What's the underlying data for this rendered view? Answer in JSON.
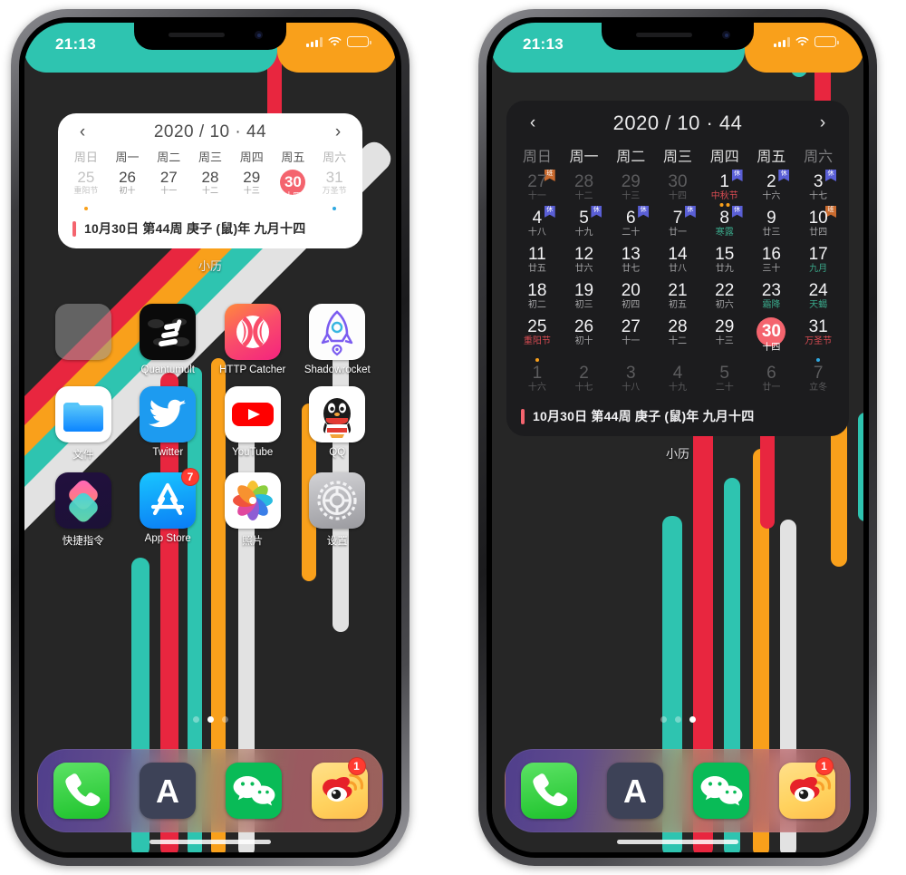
{
  "theme": {
    "teal": "#2ec4b0",
    "orange": "#f9a01b",
    "red": "#e8263f",
    "white_stripe": "#e2e2e2",
    "wallpaper_bg": "#262626",
    "today_red": "#f4646e",
    "badge_work": "#c96a2e",
    "badge_rest": "#5a5fd6",
    "app_badge_red": "#ff3b30"
  },
  "status_bar": {
    "time": "21:13",
    "signal_icon": "cellular-bars-icon",
    "wifi_icon": "wifi-icon",
    "battery_icon": "battery-icon"
  },
  "widget": {
    "prev_label": "‹",
    "next_label": "›",
    "title": "2020 / 10 · 44",
    "weekdays": [
      "周日",
      "周一",
      "周二",
      "周三",
      "周四",
      "周五",
      "周六"
    ],
    "footer_text": "10月30日 第44周 庚子 (鼠)年 九月十四",
    "app_label": "小历"
  },
  "small_widget_days": [
    {
      "num": "25",
      "sub": "重阳节",
      "out": true,
      "holiday": false,
      "dot": "#f9a01b"
    },
    {
      "num": "26",
      "sub": "初十"
    },
    {
      "num": "27",
      "sub": "十一"
    },
    {
      "num": "28",
      "sub": "十二"
    },
    {
      "num": "29",
      "sub": "十三"
    },
    {
      "num": "30",
      "sub": "十四",
      "today": true
    },
    {
      "num": "31",
      "sub": "万圣节",
      "out": true,
      "dot": "#2fa8e0"
    }
  ],
  "month_days": [
    {
      "num": "27",
      "sub": "十一",
      "out": true,
      "tag": "work",
      "tag_label": "班"
    },
    {
      "num": "28",
      "sub": "十二",
      "out": true
    },
    {
      "num": "29",
      "sub": "十三",
      "out": true
    },
    {
      "num": "30",
      "sub": "十四",
      "out": true
    },
    {
      "num": "1",
      "sub": "中秋节",
      "holiday": true,
      "tag": "rest",
      "tag_label": "休",
      "dots": [
        "#f9a01b",
        "#f9a01b"
      ]
    },
    {
      "num": "2",
      "sub": "十六",
      "tag": "rest",
      "tag_label": "休"
    },
    {
      "num": "3",
      "sub": "十七",
      "tag": "rest",
      "tag_label": "休"
    },
    {
      "num": "4",
      "sub": "十八",
      "tag": "rest",
      "tag_label": "休"
    },
    {
      "num": "5",
      "sub": "十九",
      "tag": "rest",
      "tag_label": "休"
    },
    {
      "num": "6",
      "sub": "二十",
      "tag": "rest",
      "tag_label": "休"
    },
    {
      "num": "7",
      "sub": "廿一",
      "tag": "rest",
      "tag_label": "休"
    },
    {
      "num": "8",
      "sub": "寒露",
      "term": true,
      "tag": "rest",
      "tag_label": "休"
    },
    {
      "num": "9",
      "sub": "廿三"
    },
    {
      "num": "10",
      "sub": "廿四",
      "tag": "work",
      "tag_label": "班"
    },
    {
      "num": "11",
      "sub": "廿五"
    },
    {
      "num": "12",
      "sub": "廿六"
    },
    {
      "num": "13",
      "sub": "廿七"
    },
    {
      "num": "14",
      "sub": "廿八"
    },
    {
      "num": "15",
      "sub": "廿九"
    },
    {
      "num": "16",
      "sub": "三十"
    },
    {
      "num": "17",
      "sub": "九月",
      "term": true
    },
    {
      "num": "18",
      "sub": "初二"
    },
    {
      "num": "19",
      "sub": "初三"
    },
    {
      "num": "20",
      "sub": "初四"
    },
    {
      "num": "21",
      "sub": "初五"
    },
    {
      "num": "22",
      "sub": "初六"
    },
    {
      "num": "23",
      "sub": "霜降",
      "term": true
    },
    {
      "num": "24",
      "sub": "天蝎",
      "term": true
    },
    {
      "num": "25",
      "sub": "重阳节",
      "holiday": true,
      "dot": "#f9a01b"
    },
    {
      "num": "26",
      "sub": "初十"
    },
    {
      "num": "27",
      "sub": "十一"
    },
    {
      "num": "28",
      "sub": "十二"
    },
    {
      "num": "29",
      "sub": "十三"
    },
    {
      "num": "30",
      "sub": "十四",
      "today": true
    },
    {
      "num": "31",
      "sub": "万圣节",
      "holiday": true,
      "dot": "#2fa8e0"
    },
    {
      "num": "1",
      "sub": "十六",
      "out": true
    },
    {
      "num": "2",
      "sub": "十七",
      "out": true
    },
    {
      "num": "3",
      "sub": "十八",
      "out": true
    },
    {
      "num": "4",
      "sub": "十九",
      "out": true
    },
    {
      "num": "5",
      "sub": "二十",
      "out": true
    },
    {
      "num": "6",
      "sub": "廿一",
      "out": true
    },
    {
      "num": "7",
      "sub": "立冬",
      "out": true
    }
  ],
  "home_apps": [
    {
      "name": "",
      "icon": "folder-icon",
      "row": 1,
      "col": 1
    },
    {
      "name": "Quantumult",
      "icon": "quantumult-icon",
      "row": 1,
      "col": 2
    },
    {
      "name": "HTTP Catcher",
      "icon": "http-catcher-icon",
      "row": 1,
      "col": 3
    },
    {
      "name": "Shadowrocket",
      "icon": "shadowrocket-icon",
      "row": 1,
      "col": 4
    },
    {
      "name": "文件",
      "icon": "files-icon",
      "row": 2,
      "col": 1
    },
    {
      "name": "Twitter",
      "icon": "twitter-icon",
      "row": 2,
      "col": 2
    },
    {
      "name": "YouTube",
      "icon": "youtube-icon",
      "row": 2,
      "col": 3
    },
    {
      "name": "QQ",
      "icon": "qq-icon",
      "row": 2,
      "col": 4
    },
    {
      "name": "快捷指令",
      "icon": "shortcuts-icon",
      "row": 3,
      "col": 1
    },
    {
      "name": "App Store",
      "icon": "app-store-icon",
      "row": 3,
      "col": 2,
      "badge": "7"
    },
    {
      "name": "照片",
      "icon": "photos-icon",
      "row": 3,
      "col": 3
    },
    {
      "name": "设置",
      "icon": "settings-icon",
      "row": 3,
      "col": 4
    }
  ],
  "dock_apps": [
    {
      "name": "phone-icon"
    },
    {
      "name": "alipay-icon"
    },
    {
      "name": "wechat-icon"
    },
    {
      "name": "weibo-icon",
      "badge": "1"
    }
  ],
  "pages": {
    "left_active_index": 1,
    "right_active_index": 2,
    "count": 3
  }
}
